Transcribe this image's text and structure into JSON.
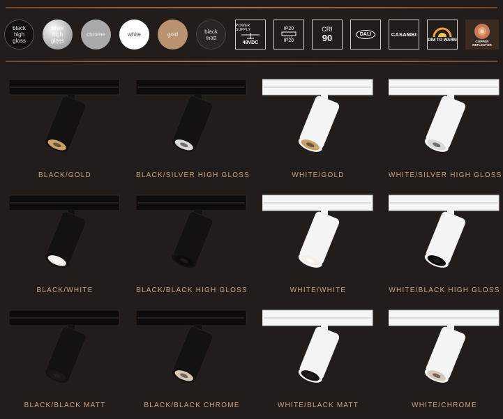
{
  "swatches": [
    {
      "key": "black_high_gloss",
      "label_lines": [
        "black",
        "high",
        "gloss"
      ]
    },
    {
      "key": "silver_high_gloss",
      "label_lines": [
        "silver",
        "high",
        "gloss"
      ]
    },
    {
      "key": "chrome",
      "label_lines": [
        "chrome"
      ]
    },
    {
      "key": "white",
      "label_lines": [
        "white"
      ]
    },
    {
      "key": "gold",
      "label_lines": [
        "gold"
      ]
    },
    {
      "key": "black_matt",
      "label_lines": [
        "black",
        "matt"
      ]
    }
  ],
  "badges": {
    "power": {
      "top": "POWER SUPPLY",
      "value": "48VDC"
    },
    "ip": {
      "top": "IP20",
      "bottom": "IP20"
    },
    "cri": {
      "top": "CRI",
      "value": "90"
    },
    "dali": {
      "label": "DALI"
    },
    "casambi": {
      "label": "CASAMBI"
    },
    "dim": {
      "label": "DIM TO WARM"
    },
    "copper": {
      "label_line1": "COPPER",
      "label_line2": "REFLECTOR"
    }
  },
  "products": [
    {
      "label": "BLACK/GOLD"
    },
    {
      "label": "BLACK/SILVER HIGH GLOSS"
    },
    {
      "label": "WHITE/GOLD"
    },
    {
      "label": "WHITE/SILVER HIGH GLOSS"
    },
    {
      "label": "BLACK/WHITE"
    },
    {
      "label": "BLACK/BLACK HIGH GLOSS"
    },
    {
      "label": "WHITE/WHITE"
    },
    {
      "label": "WHITE/BLACK HIGH GLOSS"
    },
    {
      "label": "BLACK/BLACK MATT"
    },
    {
      "label": "BLACK/BLACK CHROME"
    },
    {
      "label": "WHITE/BLACK MATT"
    },
    {
      "label": "WHITE/CHROME"
    }
  ],
  "colors": {
    "accent": "#b8906d",
    "black_body": "#151212",
    "white_body": "#f2f2f2",
    "gold": "#c9a06a",
    "silver": "#bfbfbf",
    "chrome": "#a7a9ab",
    "copper": "#b86d4b"
  }
}
